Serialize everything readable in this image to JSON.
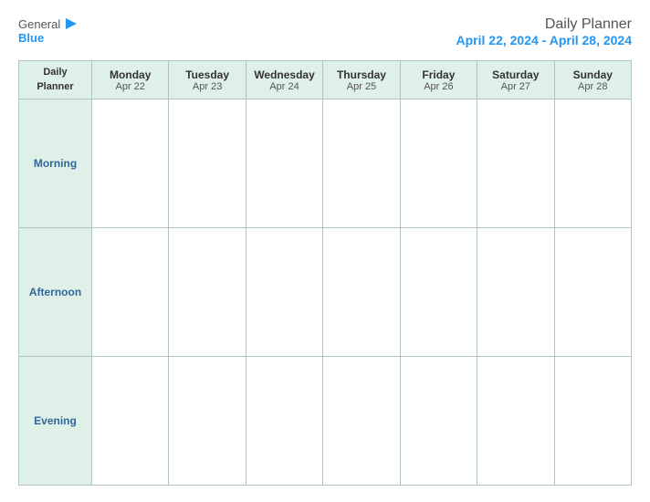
{
  "header": {
    "logo": {
      "general": "General",
      "blue": "Blue",
      "icon": "▶"
    },
    "title": "Daily Planner",
    "date_range": "April 22, 2024 - April 28, 2024"
  },
  "table": {
    "first_col_header_line1": "Daily",
    "first_col_header_line2": "Planner",
    "days": [
      {
        "name": "Monday",
        "date": "Apr 22"
      },
      {
        "name": "Tuesday",
        "date": "Apr 23"
      },
      {
        "name": "Wednesday",
        "date": "Apr 24"
      },
      {
        "name": "Thursday",
        "date": "Apr 25"
      },
      {
        "name": "Friday",
        "date": "Apr 26"
      },
      {
        "name": "Saturday",
        "date": "Apr 27"
      },
      {
        "name": "Sunday",
        "date": "Apr 28"
      }
    ],
    "time_slots": [
      "Morning",
      "Afternoon",
      "Evening"
    ]
  }
}
